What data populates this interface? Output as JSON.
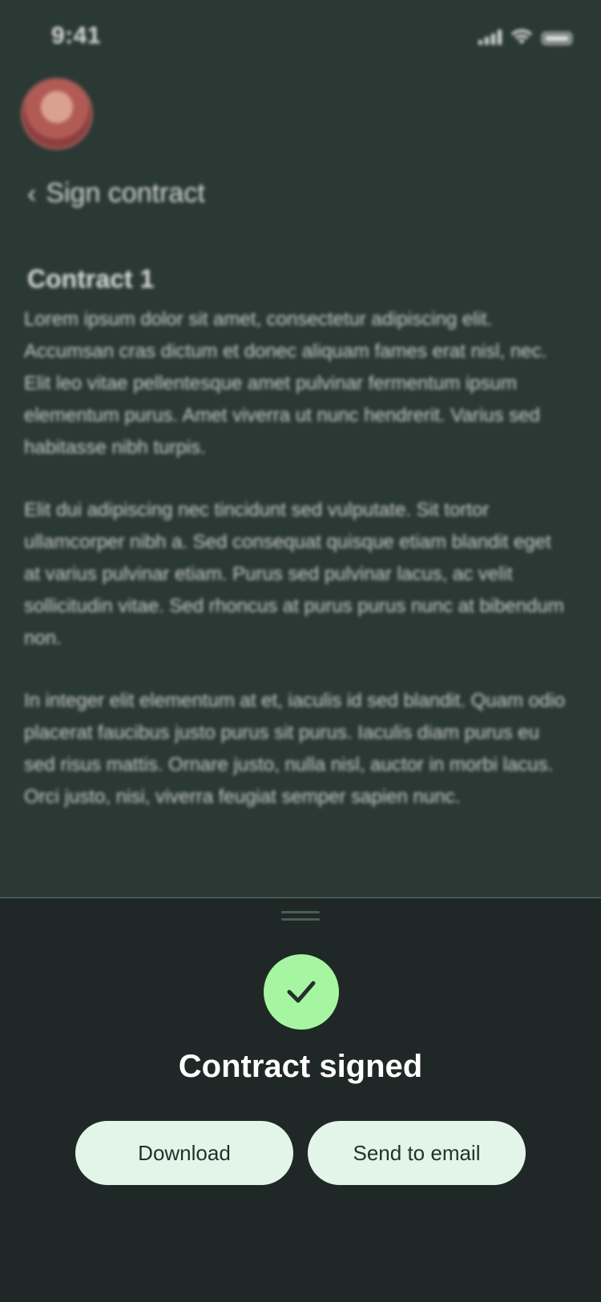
{
  "status_bar": {
    "time": "9:41"
  },
  "header": {
    "title": "Sign contract"
  },
  "document": {
    "title": "Contract 1",
    "paragraphs": [
      "Lorem ipsum dolor sit amet, consectetur adipiscing elit. Accumsan cras dictum et donec aliquam fames erat nisl, nec. Elit leo vitae pellentesque amet pulvinar fermentum ipsum elementum purus. Amet viverra ut nunc hendrerit. Varius sed habitasse nibh turpis.",
      "Elit dui adipiscing nec tincidunt sed vulputate. Sit tortor ullamcorper nibh a. Sed consequat quisque etiam blandit eget at varius pulvinar etiam. Purus sed pulvinar lacus, ac velit sollicitudin vitae. Sed rhoncus at purus purus nunc at bibendum non.",
      "In integer elit elementum at et, iaculis id sed blandit. Quam odio placerat faucibus justo purus sit purus. Iaculis diam purus eu sed risus mattis. Ornare justo, nulla nisl, auctor in morbi lacus. Orci justo, nisi, viverra feugiat semper sapien nunc."
    ]
  },
  "sheet": {
    "title": "Contract signed",
    "icon": "check-icon",
    "download_label": "Download",
    "email_label": "Send to email"
  },
  "colors": {
    "background": "#2b3935",
    "sheet": "#1f2826",
    "accent": "#a6f5a0",
    "button": "#e3f5e8"
  }
}
